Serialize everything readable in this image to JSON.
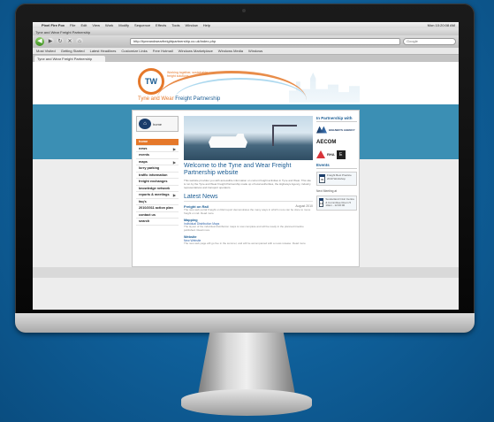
{
  "browser": {
    "menubar": {
      "items": [
        "Pixel Fire Fox",
        "File",
        "Edit",
        "View",
        "Work",
        "Modify",
        "Sequence",
        "Effects",
        "Tools",
        "Window",
        "Help"
      ],
      "clock": "Mon 10:20:08 AM"
    },
    "window_title": "Tyne and Wear Freight Partnership",
    "url": "http://tyneandwearfreightpartnership.co.uk/index.php",
    "search_placeholder": "Google",
    "bookmarks": [
      "Most Visited",
      "Getting Started",
      "Latest Headlines",
      "Customize Links",
      "Free Hotmail",
      "Windows Marketplace",
      "Windows Media",
      "Windows"
    ],
    "tab_title": "Tyne and Wear Freight Partnership"
  },
  "site": {
    "logo_letters": "TW",
    "tagline": "Working together, sustainable freight solutions",
    "title_part1": "Tyne and Wear ",
    "title_part2": "Freight Partnership",
    "home_label": "home",
    "nav": [
      {
        "label": "home",
        "arrow": ""
      },
      {
        "label": "news",
        "arrow": "▶"
      },
      {
        "label": "events",
        "arrow": ""
      },
      {
        "label": "maps",
        "arrow": "▶"
      },
      {
        "label": "lorry parking",
        "arrow": ""
      },
      {
        "label": "traffic information",
        "arrow": ""
      },
      {
        "label": "freight exchanges",
        "arrow": ""
      },
      {
        "label": "knowledge network",
        "arrow": ""
      },
      {
        "label": "reports & meetings",
        "arrow": "▶"
      },
      {
        "label": "faq's",
        "arrow": ""
      },
      {
        "label": "2010/2011 action plan",
        "arrow": ""
      },
      {
        "label": "contact us",
        "arrow": ""
      },
      {
        "label": "search",
        "arrow": ""
      }
    ],
    "welcome": "Welcome to the Tyne and Wear Freight Partnership website",
    "intro": "This website provides you with accessible information on current freight activities in Tyne and Wear. This site is run by the Tyne and Wear Freight Partnership made up of local authorities, the Highways Agency, industry representatives and transport operators.",
    "latest_news": "Latest News",
    "news": {
      "title": "Freight on Rail",
      "date": "August 2010",
      "body": "The new web portal Freight on Rail report demonstrates the many ways in which more can be done to move freight on rail. Read more"
    },
    "mapping": {
      "head": "Mapping",
      "title": "Individual Distribution Maps",
      "body": "The layout of the individual distribution maps is now complete and will be ready in the planned timeline published. Read more"
    },
    "website": {
      "head": "Website",
      "title": "New Website",
      "body": "The new web page will go live in the summer, and will be accompanied with a news release. Read more"
    },
    "partners_head": "In Partnership with",
    "partners": {
      "highways": "HIGHWAYS AGENCY",
      "aecom": "AECOM",
      "rha": "RHA",
      "e_badge": "E"
    },
    "events_head": "Events",
    "event": {
      "day": "09",
      "text": "Freight Best Practice 2010 Workshop"
    },
    "next_meeting_label": "Next Meeting at",
    "meeting": {
      "day": "14",
      "text": "Sunderland Civic Centre & Committee Room 5 10am - 12:00:00"
    }
  }
}
